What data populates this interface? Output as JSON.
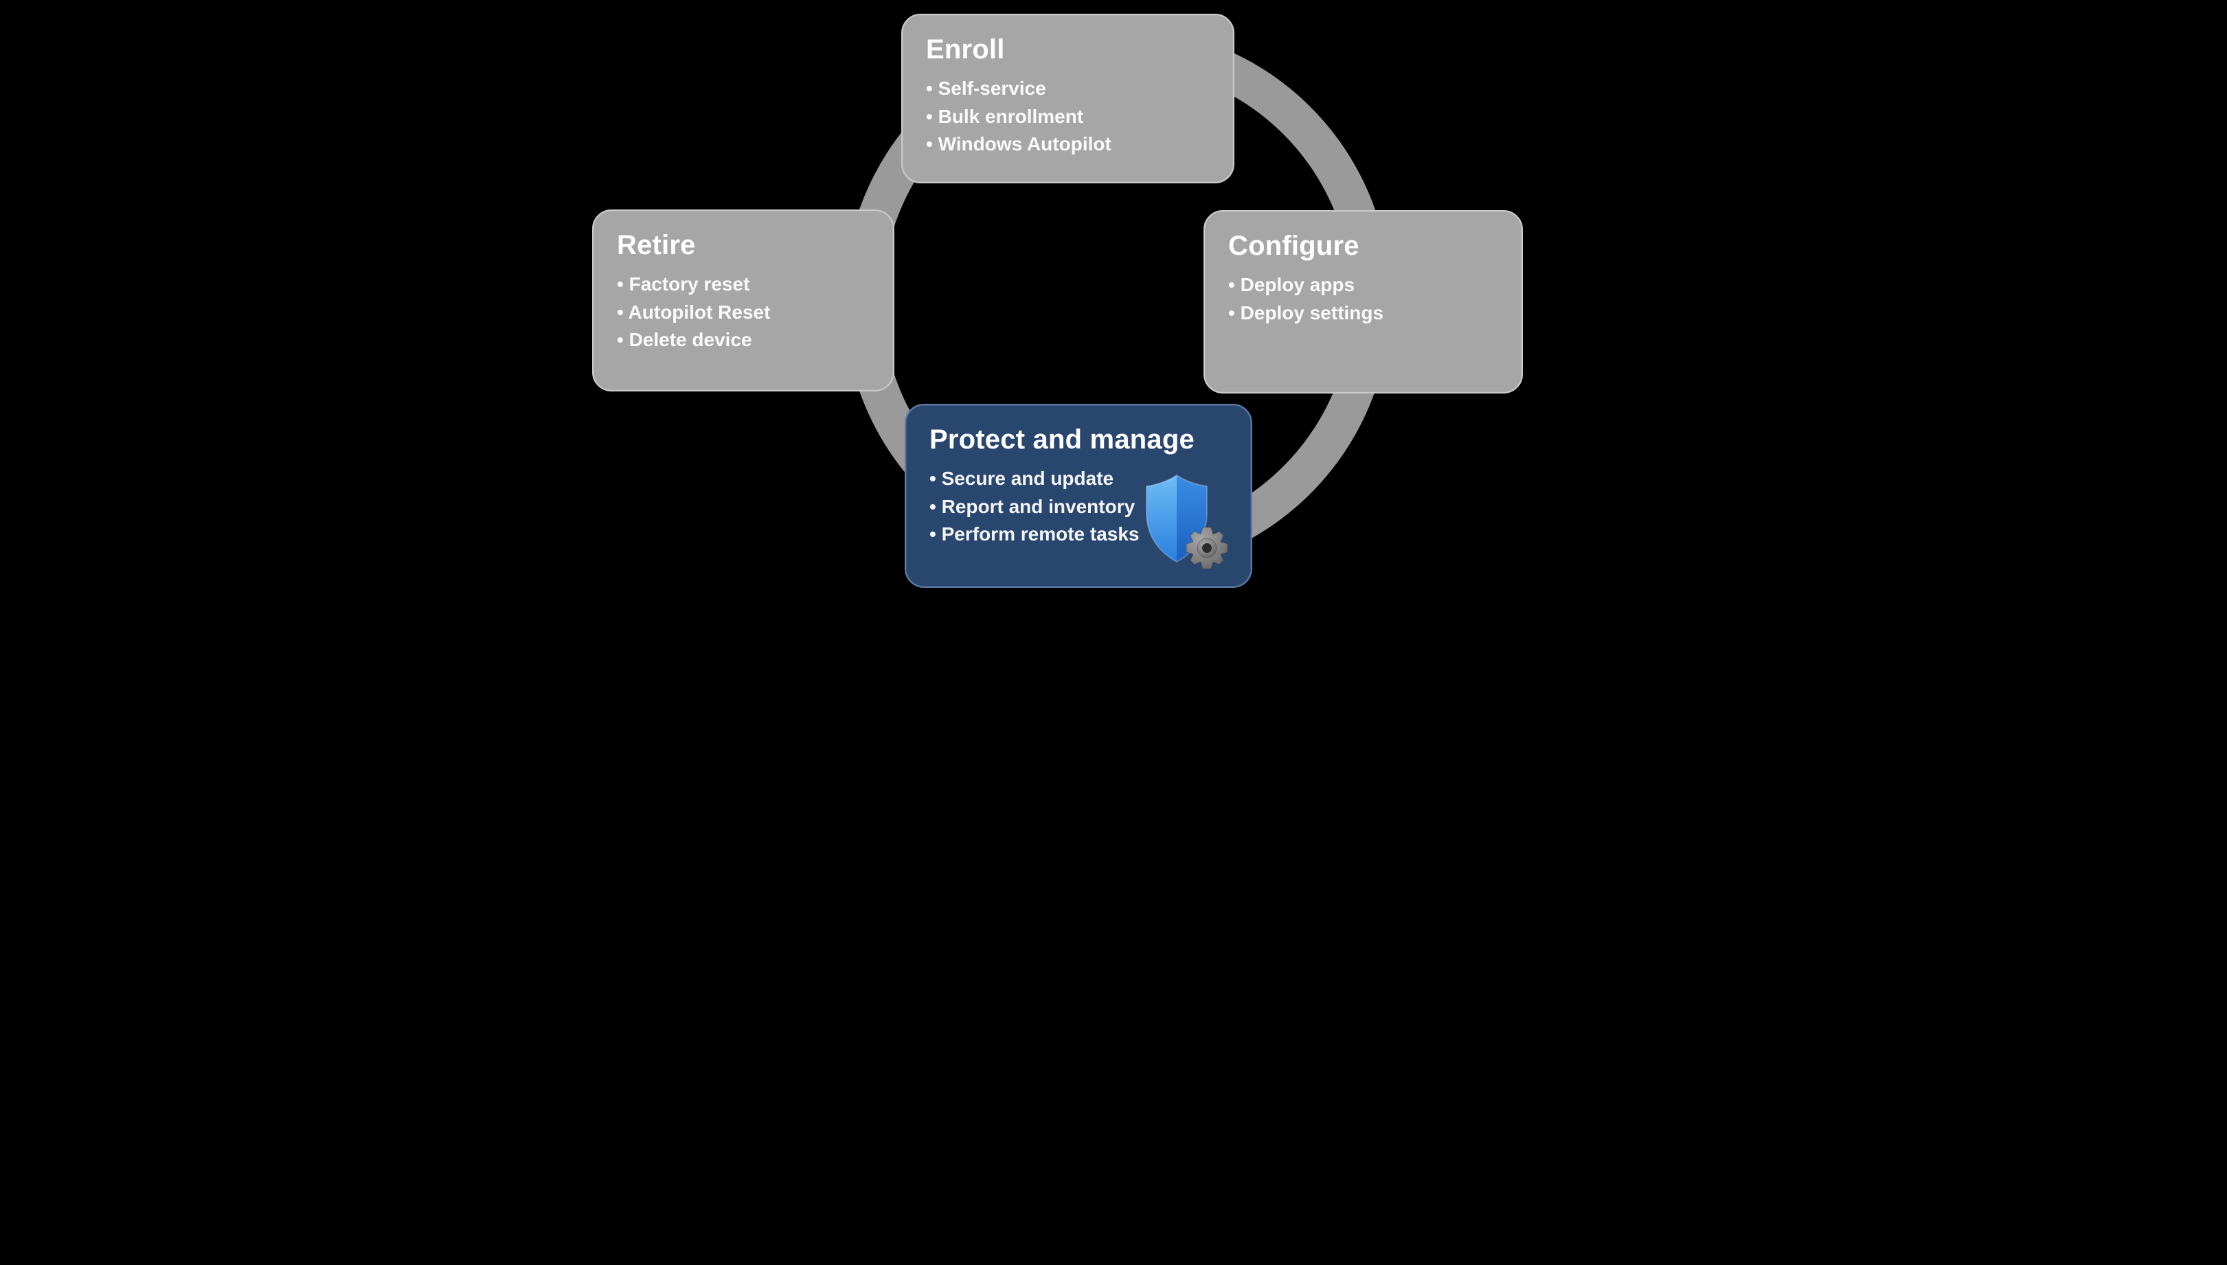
{
  "colors": {
    "inactive_card_bg": "#a6a6a6",
    "inactive_card_border": "#c9c9c9",
    "active_card_bg": "#29466e",
    "active_card_border": "#5a7ba6",
    "ring": "#b5b5b5",
    "text": "#ffffff",
    "shield_blue_top": "#4fa3e8",
    "shield_blue_bottom": "#1f6fd1",
    "gear_gray": "#7d7d7d"
  },
  "lifecycle": {
    "enroll": {
      "title": "Enroll",
      "items": [
        "Self-service",
        "Bulk enrollment",
        "Windows Autopilot"
      ]
    },
    "configure": {
      "title": "Configure",
      "items": [
        "Deploy apps",
        "Deploy settings"
      ]
    },
    "protect": {
      "title": "Protect and manage",
      "items": [
        "Secure and update",
        "Report and inventory",
        "Perform remote tasks"
      ],
      "icon": "shield-gear-icon",
      "active": true
    },
    "retire": {
      "title": "Retire",
      "items": [
        "Factory reset",
        "Autopilot Reset",
        "Delete device"
      ]
    }
  }
}
